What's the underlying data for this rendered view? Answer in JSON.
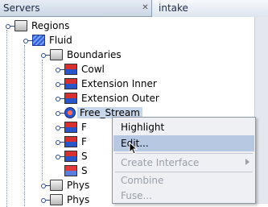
{
  "tabs": {
    "servers": "Servers",
    "intake": "intake"
  },
  "tree": {
    "regions": "Regions",
    "fluid": "Fluid",
    "boundaries": "Boundaries",
    "items": [
      "Cowl",
      "Extension Inner",
      "Extension Outer",
      "Free_Stream"
    ],
    "partial_a": "F",
    "partial_b": "F",
    "partial_c": "S",
    "partial_d": "S",
    "phys1": "Phys",
    "phys2": "Phys"
  },
  "context_menu": {
    "highlight": "Highlight",
    "edit": "Edit...",
    "create_interface": "Create Interface",
    "combine": "Combine",
    "fuse": "Fuse..."
  }
}
